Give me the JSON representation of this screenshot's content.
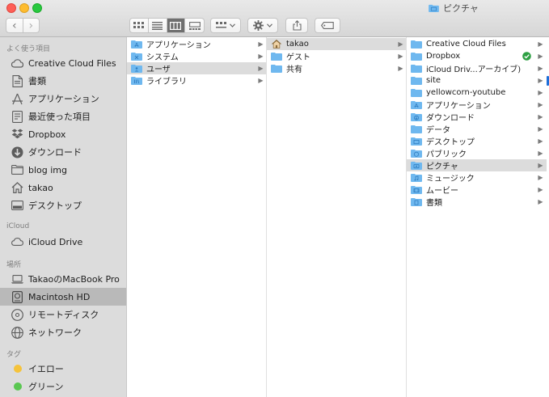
{
  "window": {
    "title": "ピクチャ"
  },
  "toolbar": {
    "back_label": "‹",
    "forward_label": "›"
  },
  "sidebar": {
    "sections": [
      {
        "header": "よく使う項目"
      },
      {
        "header": "iCloud"
      },
      {
        "header": "場所"
      },
      {
        "header": "タグ"
      }
    ],
    "items": [
      {
        "label": "Creative Cloud Files",
        "icon": "creative-cloud-icon"
      },
      {
        "label": "書類",
        "icon": "document-icon"
      },
      {
        "label": "アプリケーション",
        "icon": "applications-icon"
      },
      {
        "label": "最近使った項目",
        "icon": "recent-icon"
      },
      {
        "label": "Dropbox",
        "icon": "dropbox-icon"
      },
      {
        "label": "ダウンロード",
        "icon": "download-icon"
      },
      {
        "label": "blog img",
        "icon": "folder-icon"
      },
      {
        "label": "takao",
        "icon": "home-icon"
      },
      {
        "label": "デスクトップ",
        "icon": "desktop-icon"
      },
      {
        "label": "iCloud Drive",
        "icon": "cloud-icon"
      },
      {
        "label": "TakaoのMacBook Pro",
        "icon": "laptop-icon"
      },
      {
        "label": "Macintosh HD",
        "icon": "hard-drive-icon",
        "selected": true
      },
      {
        "label": "リモートディスク",
        "icon": "disc-icon"
      },
      {
        "label": "ネットワーク",
        "icon": "network-icon"
      },
      {
        "label": "イエロー",
        "icon": "tag-yellow-icon",
        "color": "#f5c33b"
      },
      {
        "label": "グリーン",
        "icon": "tag-green-icon",
        "color": "#5ac751"
      }
    ]
  },
  "columns": [
    {
      "items": [
        {
          "label": "アプリケーション",
          "has_children": true
        },
        {
          "label": "システム",
          "has_children": true
        },
        {
          "label": "ユーザ",
          "has_children": true,
          "selected": true
        },
        {
          "label": "ライブラリ",
          "has_children": true
        }
      ]
    },
    {
      "items": [
        {
          "label": "takao",
          "has_children": true,
          "selected": true,
          "icon": "home-icon"
        },
        {
          "label": "ゲスト",
          "has_children": true
        },
        {
          "label": "共有",
          "has_children": true
        }
      ]
    },
    {
      "items": [
        {
          "label": "Creative Cloud Files",
          "has_children": true
        },
        {
          "label": "Dropbox",
          "has_children": true,
          "badge": "synced-check-icon"
        },
        {
          "label": "iCloud Driv...アーカイブ)",
          "has_children": true
        },
        {
          "label": "site",
          "has_children": true
        },
        {
          "label": "yellowcorn-youtube",
          "has_children": true
        },
        {
          "label": "アプリケーション",
          "has_children": true
        },
        {
          "label": "ダウンロード",
          "has_children": true
        },
        {
          "label": "データ",
          "has_children": true
        },
        {
          "label": "デスクトップ",
          "has_children": true
        },
        {
          "label": "パブリック",
          "has_children": true
        },
        {
          "label": "ピクチャ",
          "has_children": true,
          "selected": true
        },
        {
          "label": "ミュージック",
          "has_children": true
        },
        {
          "label": "ムービー",
          "has_children": true
        },
        {
          "label": "書類",
          "has_children": true
        }
      ]
    }
  ],
  "colors": {
    "folder": "#6fb8ef",
    "selection": "#dcdcdc",
    "sidebar_bg": "#dcdcdc",
    "accent_check": "#2ea043"
  }
}
